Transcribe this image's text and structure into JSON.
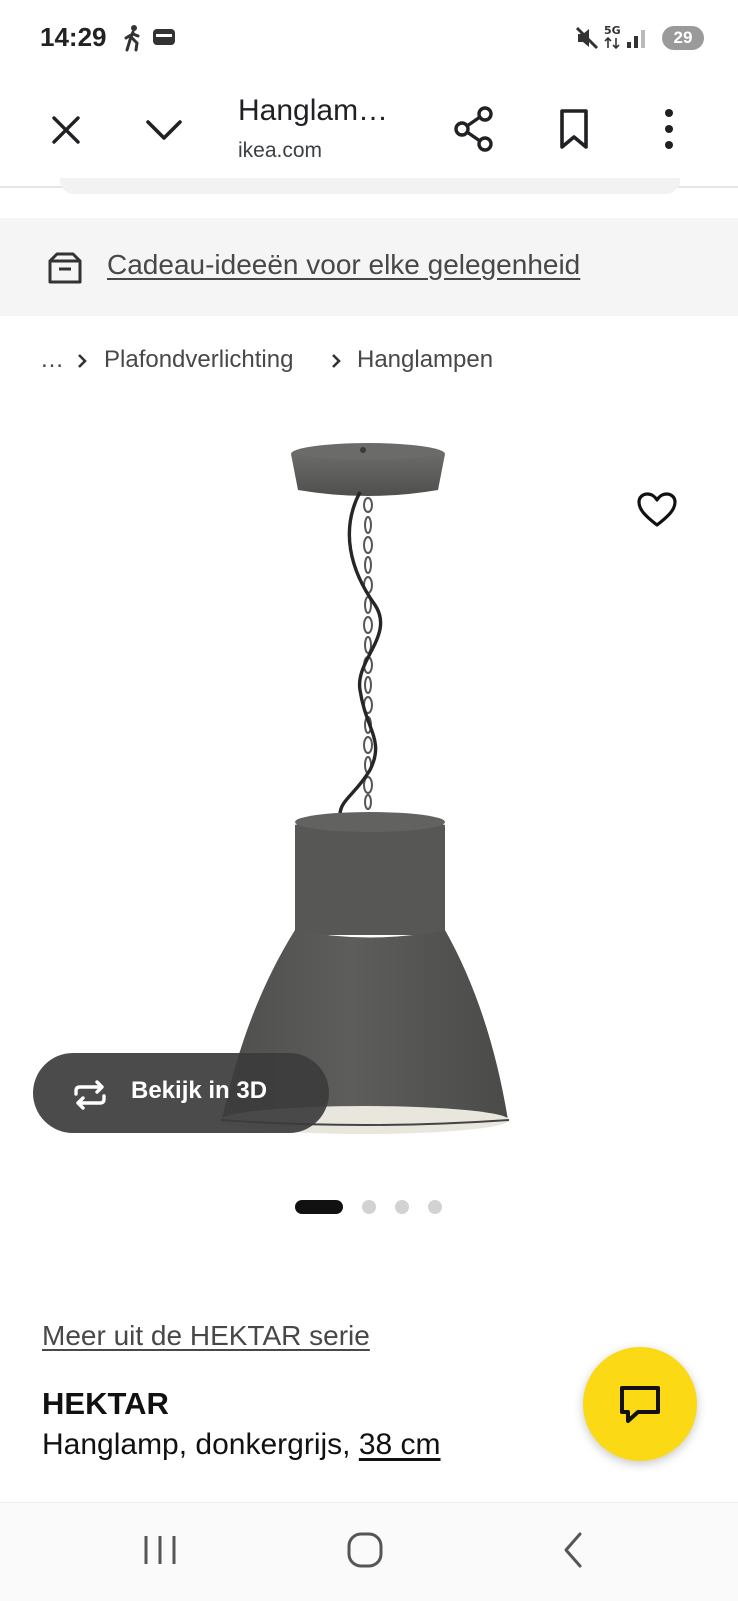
{
  "status_bar": {
    "time": "14:29",
    "battery": "29"
  },
  "toolbar": {
    "title": "Hanglam…",
    "domain": "ikea.com"
  },
  "promo": {
    "text": "Cadeau-ideeën voor elke gelegenheid"
  },
  "breadcrumb": {
    "ellipsis": "…",
    "items": [
      "Plafondverlichting",
      "Hanglampen"
    ]
  },
  "media": {
    "view3d_label": "Bekijk in 3D",
    "slides": 4,
    "active_slide": 1
  },
  "product": {
    "series_link": "Meer uit de HEKTAR serie",
    "name": "HEKTAR",
    "description": "Hanglamp, donkergrijs,",
    "size": "38 cm"
  },
  "colors": {
    "accent_yellow": "#fbd914",
    "lamp_grey": "#5a5b59"
  }
}
